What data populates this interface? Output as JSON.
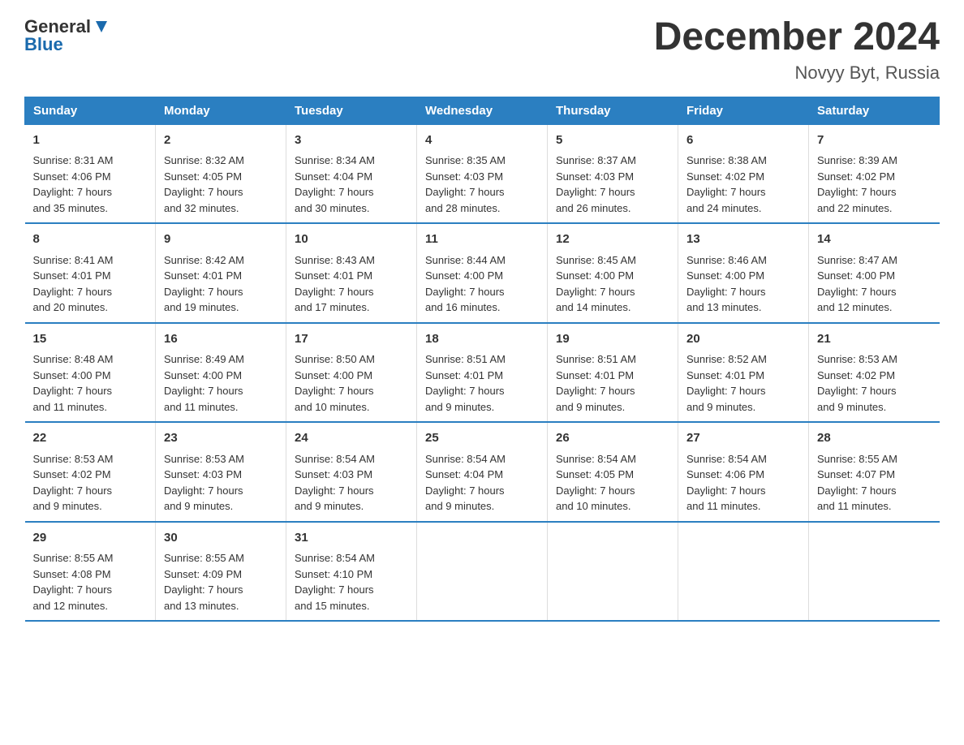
{
  "logo": {
    "general": "General",
    "blue": "Blue"
  },
  "title": "December 2024",
  "location": "Novyy Byt, Russia",
  "days_of_week": [
    "Sunday",
    "Monday",
    "Tuesday",
    "Wednesday",
    "Thursday",
    "Friday",
    "Saturday"
  ],
  "weeks": [
    [
      {
        "day": "1",
        "sunrise": "Sunrise: 8:31 AM",
        "sunset": "Sunset: 4:06 PM",
        "daylight": "Daylight: 7 hours",
        "daylight2": "and 35 minutes."
      },
      {
        "day": "2",
        "sunrise": "Sunrise: 8:32 AM",
        "sunset": "Sunset: 4:05 PM",
        "daylight": "Daylight: 7 hours",
        "daylight2": "and 32 minutes."
      },
      {
        "day": "3",
        "sunrise": "Sunrise: 8:34 AM",
        "sunset": "Sunset: 4:04 PM",
        "daylight": "Daylight: 7 hours",
        "daylight2": "and 30 minutes."
      },
      {
        "day": "4",
        "sunrise": "Sunrise: 8:35 AM",
        "sunset": "Sunset: 4:03 PM",
        "daylight": "Daylight: 7 hours",
        "daylight2": "and 28 minutes."
      },
      {
        "day": "5",
        "sunrise": "Sunrise: 8:37 AM",
        "sunset": "Sunset: 4:03 PM",
        "daylight": "Daylight: 7 hours",
        "daylight2": "and 26 minutes."
      },
      {
        "day": "6",
        "sunrise": "Sunrise: 8:38 AM",
        "sunset": "Sunset: 4:02 PM",
        "daylight": "Daylight: 7 hours",
        "daylight2": "and 24 minutes."
      },
      {
        "day": "7",
        "sunrise": "Sunrise: 8:39 AM",
        "sunset": "Sunset: 4:02 PM",
        "daylight": "Daylight: 7 hours",
        "daylight2": "and 22 minutes."
      }
    ],
    [
      {
        "day": "8",
        "sunrise": "Sunrise: 8:41 AM",
        "sunset": "Sunset: 4:01 PM",
        "daylight": "Daylight: 7 hours",
        "daylight2": "and 20 minutes."
      },
      {
        "day": "9",
        "sunrise": "Sunrise: 8:42 AM",
        "sunset": "Sunset: 4:01 PM",
        "daylight": "Daylight: 7 hours",
        "daylight2": "and 19 minutes."
      },
      {
        "day": "10",
        "sunrise": "Sunrise: 8:43 AM",
        "sunset": "Sunset: 4:01 PM",
        "daylight": "Daylight: 7 hours",
        "daylight2": "and 17 minutes."
      },
      {
        "day": "11",
        "sunrise": "Sunrise: 8:44 AM",
        "sunset": "Sunset: 4:00 PM",
        "daylight": "Daylight: 7 hours",
        "daylight2": "and 16 minutes."
      },
      {
        "day": "12",
        "sunrise": "Sunrise: 8:45 AM",
        "sunset": "Sunset: 4:00 PM",
        "daylight": "Daylight: 7 hours",
        "daylight2": "and 14 minutes."
      },
      {
        "day": "13",
        "sunrise": "Sunrise: 8:46 AM",
        "sunset": "Sunset: 4:00 PM",
        "daylight": "Daylight: 7 hours",
        "daylight2": "and 13 minutes."
      },
      {
        "day": "14",
        "sunrise": "Sunrise: 8:47 AM",
        "sunset": "Sunset: 4:00 PM",
        "daylight": "Daylight: 7 hours",
        "daylight2": "and 12 minutes."
      }
    ],
    [
      {
        "day": "15",
        "sunrise": "Sunrise: 8:48 AM",
        "sunset": "Sunset: 4:00 PM",
        "daylight": "Daylight: 7 hours",
        "daylight2": "and 11 minutes."
      },
      {
        "day": "16",
        "sunrise": "Sunrise: 8:49 AM",
        "sunset": "Sunset: 4:00 PM",
        "daylight": "Daylight: 7 hours",
        "daylight2": "and 11 minutes."
      },
      {
        "day": "17",
        "sunrise": "Sunrise: 8:50 AM",
        "sunset": "Sunset: 4:00 PM",
        "daylight": "Daylight: 7 hours",
        "daylight2": "and 10 minutes."
      },
      {
        "day": "18",
        "sunrise": "Sunrise: 8:51 AM",
        "sunset": "Sunset: 4:01 PM",
        "daylight": "Daylight: 7 hours",
        "daylight2": "and 9 minutes."
      },
      {
        "day": "19",
        "sunrise": "Sunrise: 8:51 AM",
        "sunset": "Sunset: 4:01 PM",
        "daylight": "Daylight: 7 hours",
        "daylight2": "and 9 minutes."
      },
      {
        "day": "20",
        "sunrise": "Sunrise: 8:52 AM",
        "sunset": "Sunset: 4:01 PM",
        "daylight": "Daylight: 7 hours",
        "daylight2": "and 9 minutes."
      },
      {
        "day": "21",
        "sunrise": "Sunrise: 8:53 AM",
        "sunset": "Sunset: 4:02 PM",
        "daylight": "Daylight: 7 hours",
        "daylight2": "and 9 minutes."
      }
    ],
    [
      {
        "day": "22",
        "sunrise": "Sunrise: 8:53 AM",
        "sunset": "Sunset: 4:02 PM",
        "daylight": "Daylight: 7 hours",
        "daylight2": "and 9 minutes."
      },
      {
        "day": "23",
        "sunrise": "Sunrise: 8:53 AM",
        "sunset": "Sunset: 4:03 PM",
        "daylight": "Daylight: 7 hours",
        "daylight2": "and 9 minutes."
      },
      {
        "day": "24",
        "sunrise": "Sunrise: 8:54 AM",
        "sunset": "Sunset: 4:03 PM",
        "daylight": "Daylight: 7 hours",
        "daylight2": "and 9 minutes."
      },
      {
        "day": "25",
        "sunrise": "Sunrise: 8:54 AM",
        "sunset": "Sunset: 4:04 PM",
        "daylight": "Daylight: 7 hours",
        "daylight2": "and 9 minutes."
      },
      {
        "day": "26",
        "sunrise": "Sunrise: 8:54 AM",
        "sunset": "Sunset: 4:05 PM",
        "daylight": "Daylight: 7 hours",
        "daylight2": "and 10 minutes."
      },
      {
        "day": "27",
        "sunrise": "Sunrise: 8:54 AM",
        "sunset": "Sunset: 4:06 PM",
        "daylight": "Daylight: 7 hours",
        "daylight2": "and 11 minutes."
      },
      {
        "day": "28",
        "sunrise": "Sunrise: 8:55 AM",
        "sunset": "Sunset: 4:07 PM",
        "daylight": "Daylight: 7 hours",
        "daylight2": "and 11 minutes."
      }
    ],
    [
      {
        "day": "29",
        "sunrise": "Sunrise: 8:55 AM",
        "sunset": "Sunset: 4:08 PM",
        "daylight": "Daylight: 7 hours",
        "daylight2": "and 12 minutes."
      },
      {
        "day": "30",
        "sunrise": "Sunrise: 8:55 AM",
        "sunset": "Sunset: 4:09 PM",
        "daylight": "Daylight: 7 hours",
        "daylight2": "and 13 minutes."
      },
      {
        "day": "31",
        "sunrise": "Sunrise: 8:54 AM",
        "sunset": "Sunset: 4:10 PM",
        "daylight": "Daylight: 7 hours",
        "daylight2": "and 15 minutes."
      },
      null,
      null,
      null,
      null
    ]
  ]
}
